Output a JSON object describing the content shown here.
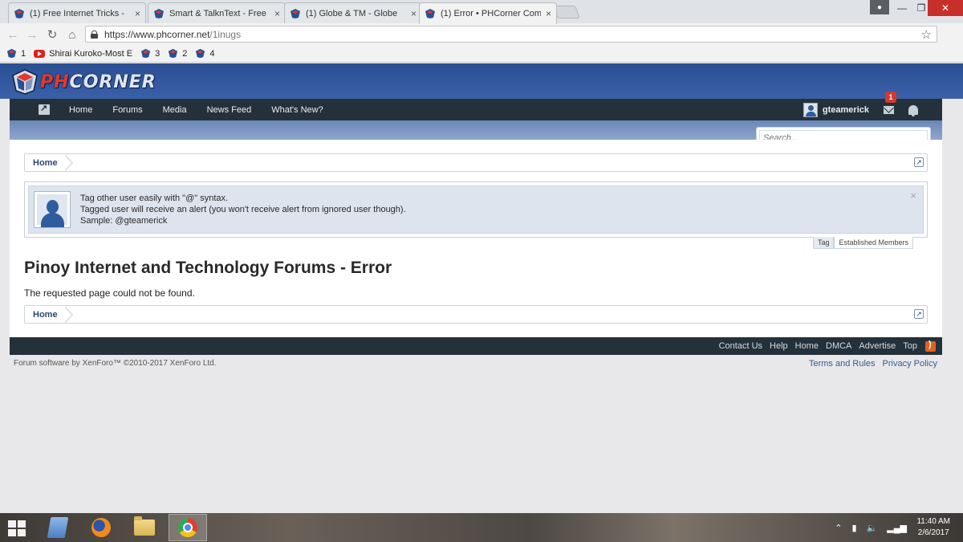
{
  "browser": {
    "tabs": [
      {
        "title": "(1) Free Internet Tricks - "
      },
      {
        "title": "Smart & TalknText - Free"
      },
      {
        "title": "(1) Globe & TM - Globe "
      },
      {
        "title": "(1) Error • PHCorner Com",
        "active": true
      }
    ],
    "close_glyph": "×",
    "url_host": "https://www.phcorner.net",
    "url_path": "/1inugs",
    "bookmarks": [
      {
        "label": "1",
        "icon": "phcorner-favicon"
      },
      {
        "label": "Shirai Kuroko-Most E",
        "icon": "youtube-icon"
      },
      {
        "label": "3",
        "icon": "phcorner-favicon"
      },
      {
        "label": "2",
        "icon": "phcorner-favicon"
      },
      {
        "label": "4",
        "icon": "phcorner-favicon"
      }
    ]
  },
  "site": {
    "logo_text_main": "PH",
    "logo_text_rest": "CORNER",
    "nav": [
      "Home",
      "Forums",
      "Media",
      "News Feed",
      "What's New?"
    ],
    "username": "gteamerick",
    "alert_count": "1",
    "search_placeholder": "Search..."
  },
  "breadcrumb": {
    "home": "Home"
  },
  "notice": {
    "line1": "Tag other user easily with \"@\" syntax.",
    "line2": "Tagged user will receive an alert (you won't receive alert from ignored user though).",
    "line3": "Sample: @gteamerick",
    "close": "×",
    "tabs": [
      "Tag",
      "Established Members"
    ]
  },
  "page": {
    "title": "Pinoy Internet and Technology Forums - Error",
    "message": "The requested page could not be found."
  },
  "footer": {
    "links": [
      "Contact Us",
      "Help",
      "Home",
      "DMCA",
      "Advertise",
      "Top"
    ],
    "copyright": "Forum software by XenForo™ ©2010-2017 XenForo Ltd.",
    "legal": [
      "Terms and Rules",
      "Privacy Policy"
    ]
  },
  "taskbar": {
    "time": "11:40 AM",
    "date": "2/6/2017"
  },
  "colors": {
    "header_blue": "#2b4f93",
    "navbar_dark": "#25313a",
    "alert_red": "#d23a2f",
    "link_blue": "#3a5a8c"
  }
}
